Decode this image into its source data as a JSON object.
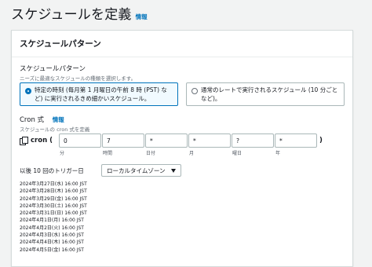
{
  "page": {
    "title": "スケジュールを定義",
    "info": "情報"
  },
  "panel": {
    "title": "スケジュールパターン",
    "pattern_label": "スケジュールパターン",
    "pattern_desc": "ニーズに最適なスケジュールの種類を選択します。",
    "options": [
      {
        "label": "特定の時刻 (毎月第 1 月曜日の午前 8 時 (PST) など) に実行されるきめ細かいスケジュール。",
        "selected": true
      },
      {
        "label": "通常のレートで実行されるスケジュール (10 分ごとなど)。",
        "selected": false
      }
    ],
    "cron_label": "Cron 式",
    "cron_info": "情報",
    "cron_desc": "スケジュールの cron 式を定義",
    "cron_prefix": "cron (",
    "cron_fields": [
      {
        "value": "0",
        "caption": "分"
      },
      {
        "value": "7",
        "caption": "時間"
      },
      {
        "value": "*",
        "caption": "日付"
      },
      {
        "value": "*",
        "caption": "月"
      },
      {
        "value": "?",
        "caption": "曜日"
      },
      {
        "value": "*",
        "caption": "年"
      }
    ],
    "cron_suffix": ")",
    "trigger_label": "以後 10 回のトリガー日",
    "timezone": "ローカルタイムゾーン",
    "triggers": [
      "2024年3月27日(水) 16:00 JST",
      "2024年3月28日(木) 16:00 JST",
      "2024年3月29日(金) 16:00 JST",
      "2024年3月30日(土) 16:00 JST",
      "2024年3月31日(日) 16:00 JST",
      "2024年4月1日(月) 16:00 JST",
      "2024年4月2日(火) 16:00 JST",
      "2024年4月3日(水) 16:00 JST",
      "2024年4月4日(木) 16:00 JST",
      "2024年4月5日(金) 16:00 JST"
    ]
  }
}
